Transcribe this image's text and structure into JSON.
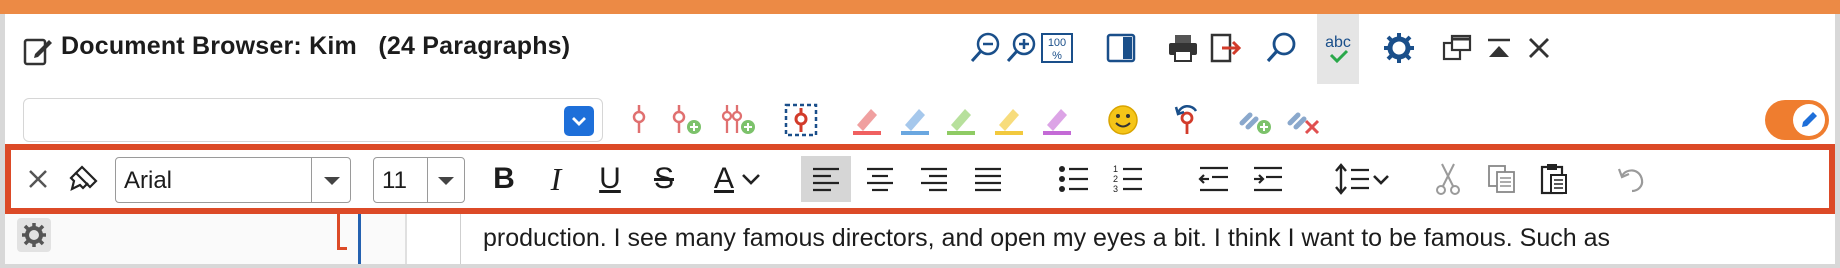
{
  "window": {
    "title": "Document Browser: Kim   (24 Paragraphs)"
  },
  "title_toolbar": {
    "icons": [
      "zoom-out-icon",
      "zoom-in-icon",
      "zoom-100-icon",
      "split-panel-icon",
      "print-icon",
      "export-icon",
      "search-icon",
      "spellcheck-icon",
      "settings-icon",
      "undock-icon",
      "collapse-icon",
      "close-icon"
    ],
    "zoom_100_label": "100",
    "spellcheck_label": "abc"
  },
  "code_toolbar": {
    "code_select_value": "",
    "icons": [
      "code-icon",
      "code-add-icon",
      "code-multi-add-icon",
      "code-frame-icon",
      "highlight-red-icon",
      "highlight-blue-icon",
      "highlight-green-icon",
      "highlight-yellow-icon",
      "highlight-purple-icon",
      "emoticon-icon",
      "code-undo-icon",
      "link-add-icon",
      "link-remove-icon"
    ],
    "edit_mode": true
  },
  "format_toolbar": {
    "font_family": "Arial",
    "font_size": "11",
    "bold_label": "B",
    "italic_label": "I",
    "underline_label": "U",
    "strike_label": "S",
    "font_color_label": "A",
    "active_alignment": "left",
    "colors": {
      "highlight_border": "#dc4a27",
      "accent": "#1e6fd9",
      "toggle": "#ef7d2f"
    }
  },
  "document": {
    "visible_text": "production. I see many famous directors, and open my eyes a bit. I think I want to be famous. Such as"
  }
}
